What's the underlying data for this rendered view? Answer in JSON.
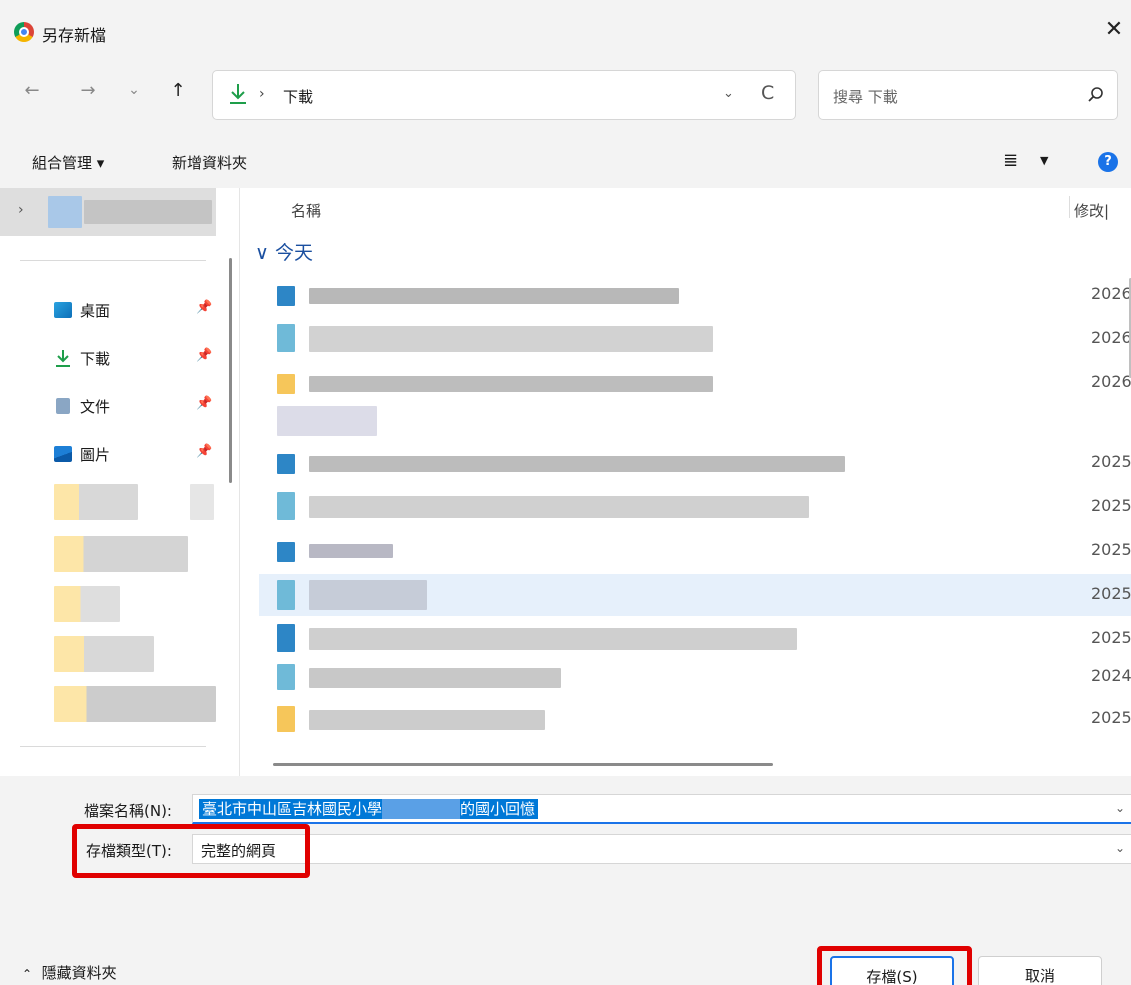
{
  "window": {
    "title": "另存新檔",
    "close_label": "✕"
  },
  "nav": {
    "back": "←",
    "forward": "→",
    "recent": "⌄",
    "up": "↑",
    "address_sep": "›",
    "address_location": "下載",
    "refresh": "C",
    "search_placeholder": "搜尋 下載"
  },
  "commands": {
    "organize": "組合管理 ▾",
    "new_folder": "新增資料夾",
    "help": "?"
  },
  "sidebar": {
    "quick_access": [
      {
        "label": "桌面",
        "icon": "desktop-icon"
      },
      {
        "label": "下載",
        "icon": "download-icon"
      },
      {
        "label": "文件",
        "icon": "document-icon"
      },
      {
        "label": "圖片",
        "icon": "pictures-icon"
      }
    ]
  },
  "file_list": {
    "columns": [
      "名稱",
      "修改|"
    ],
    "group_today": "今天",
    "dates": [
      "2026",
      "2026",
      "2026",
      "2025",
      "2025",
      "2025",
      "2025",
      "2025",
      "2024",
      "2025"
    ]
  },
  "form": {
    "filename_label": "檔案名稱(N):",
    "filename_part1": "臺北市中山區吉林國民小學",
    "filename_part2": "的國小回憶",
    "filetype_label": "存檔類型(T):",
    "filetype_value": "完整的網頁"
  },
  "footer": {
    "hide_folders": "隱藏資料夾",
    "save_button": "存檔(S)",
    "cancel_button": "取消"
  },
  "colors": {
    "accent": "#1a73e8",
    "highlight_box": "#e00000",
    "selection": "#0078d7"
  }
}
